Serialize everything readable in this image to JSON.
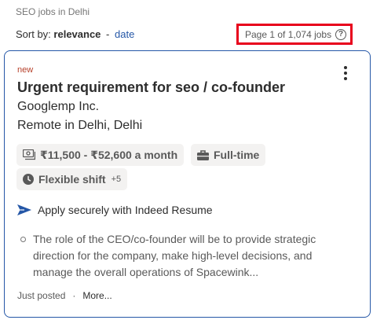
{
  "header": {
    "breadcrumb": "SEO jobs in Delhi",
    "sort_label": "Sort by:",
    "sort_active": "relevance",
    "sort_separator": "-",
    "sort_alternate": "date",
    "page_count": "Page 1 of 1,074 jobs",
    "help_icon": "?"
  },
  "job": {
    "badge": "new",
    "title": "Urgent requirement for seo / co-founder",
    "company": "Googlemp Inc.",
    "location": "Remote in Delhi, Delhi",
    "salary": "₹11,500 - ₹52,600 a month",
    "job_type": "Full-time",
    "shift": "Flexible shift",
    "shift_extra": "+5",
    "apply_text": "Apply securely with Indeed Resume",
    "snippet": "The role of the CEO/co-founder will be to provide strategic direction for the company, make high-level decisions, and manage the overall operations of Spacewink...",
    "posted": "Just posted",
    "footer_dot": "·",
    "more_label": "More..."
  },
  "icons": {
    "salary": "money-icon",
    "job_type": "briefcase-icon",
    "shift": "clock-icon",
    "apply": "send-arrow-icon",
    "menu": "kebab-menu-icon",
    "help": "help-icon"
  },
  "colors": {
    "accent": "#2557a7",
    "highlight_border": "#e8001c",
    "new_badge": "#b7412b",
    "chip_bg": "#f3f2f1"
  }
}
